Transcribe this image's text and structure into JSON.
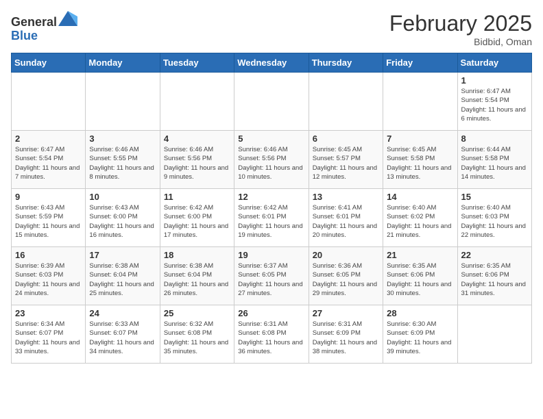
{
  "header": {
    "logo_general": "General",
    "logo_blue": "Blue",
    "month_title": "February 2025",
    "subtitle": "Bidbid, Oman"
  },
  "days_of_week": [
    "Sunday",
    "Monday",
    "Tuesday",
    "Wednesday",
    "Thursday",
    "Friday",
    "Saturday"
  ],
  "weeks": [
    [
      {
        "day": "",
        "info": ""
      },
      {
        "day": "",
        "info": ""
      },
      {
        "day": "",
        "info": ""
      },
      {
        "day": "",
        "info": ""
      },
      {
        "day": "",
        "info": ""
      },
      {
        "day": "",
        "info": ""
      },
      {
        "day": "1",
        "info": "Sunrise: 6:47 AM\nSunset: 5:54 PM\nDaylight: 11 hours and 6 minutes."
      }
    ],
    [
      {
        "day": "2",
        "info": "Sunrise: 6:47 AM\nSunset: 5:54 PM\nDaylight: 11 hours and 7 minutes."
      },
      {
        "day": "3",
        "info": "Sunrise: 6:46 AM\nSunset: 5:55 PM\nDaylight: 11 hours and 8 minutes."
      },
      {
        "day": "4",
        "info": "Sunrise: 6:46 AM\nSunset: 5:56 PM\nDaylight: 11 hours and 9 minutes."
      },
      {
        "day": "5",
        "info": "Sunrise: 6:46 AM\nSunset: 5:56 PM\nDaylight: 11 hours and 10 minutes."
      },
      {
        "day": "6",
        "info": "Sunrise: 6:45 AM\nSunset: 5:57 PM\nDaylight: 11 hours and 12 minutes."
      },
      {
        "day": "7",
        "info": "Sunrise: 6:45 AM\nSunset: 5:58 PM\nDaylight: 11 hours and 13 minutes."
      },
      {
        "day": "8",
        "info": "Sunrise: 6:44 AM\nSunset: 5:58 PM\nDaylight: 11 hours and 14 minutes."
      }
    ],
    [
      {
        "day": "9",
        "info": "Sunrise: 6:43 AM\nSunset: 5:59 PM\nDaylight: 11 hours and 15 minutes."
      },
      {
        "day": "10",
        "info": "Sunrise: 6:43 AM\nSunset: 6:00 PM\nDaylight: 11 hours and 16 minutes."
      },
      {
        "day": "11",
        "info": "Sunrise: 6:42 AM\nSunset: 6:00 PM\nDaylight: 11 hours and 17 minutes."
      },
      {
        "day": "12",
        "info": "Sunrise: 6:42 AM\nSunset: 6:01 PM\nDaylight: 11 hours and 19 minutes."
      },
      {
        "day": "13",
        "info": "Sunrise: 6:41 AM\nSunset: 6:01 PM\nDaylight: 11 hours and 20 minutes."
      },
      {
        "day": "14",
        "info": "Sunrise: 6:40 AM\nSunset: 6:02 PM\nDaylight: 11 hours and 21 minutes."
      },
      {
        "day": "15",
        "info": "Sunrise: 6:40 AM\nSunset: 6:03 PM\nDaylight: 11 hours and 22 minutes."
      }
    ],
    [
      {
        "day": "16",
        "info": "Sunrise: 6:39 AM\nSunset: 6:03 PM\nDaylight: 11 hours and 24 minutes."
      },
      {
        "day": "17",
        "info": "Sunrise: 6:38 AM\nSunset: 6:04 PM\nDaylight: 11 hours and 25 minutes."
      },
      {
        "day": "18",
        "info": "Sunrise: 6:38 AM\nSunset: 6:04 PM\nDaylight: 11 hours and 26 minutes."
      },
      {
        "day": "19",
        "info": "Sunrise: 6:37 AM\nSunset: 6:05 PM\nDaylight: 11 hours and 27 minutes."
      },
      {
        "day": "20",
        "info": "Sunrise: 6:36 AM\nSunset: 6:05 PM\nDaylight: 11 hours and 29 minutes."
      },
      {
        "day": "21",
        "info": "Sunrise: 6:35 AM\nSunset: 6:06 PM\nDaylight: 11 hours and 30 minutes."
      },
      {
        "day": "22",
        "info": "Sunrise: 6:35 AM\nSunset: 6:06 PM\nDaylight: 11 hours and 31 minutes."
      }
    ],
    [
      {
        "day": "23",
        "info": "Sunrise: 6:34 AM\nSunset: 6:07 PM\nDaylight: 11 hours and 33 minutes."
      },
      {
        "day": "24",
        "info": "Sunrise: 6:33 AM\nSunset: 6:07 PM\nDaylight: 11 hours and 34 minutes."
      },
      {
        "day": "25",
        "info": "Sunrise: 6:32 AM\nSunset: 6:08 PM\nDaylight: 11 hours and 35 minutes."
      },
      {
        "day": "26",
        "info": "Sunrise: 6:31 AM\nSunset: 6:08 PM\nDaylight: 11 hours and 36 minutes."
      },
      {
        "day": "27",
        "info": "Sunrise: 6:31 AM\nSunset: 6:09 PM\nDaylight: 11 hours and 38 minutes."
      },
      {
        "day": "28",
        "info": "Sunrise: 6:30 AM\nSunset: 6:09 PM\nDaylight: 11 hours and 39 minutes."
      },
      {
        "day": "",
        "info": ""
      }
    ]
  ]
}
